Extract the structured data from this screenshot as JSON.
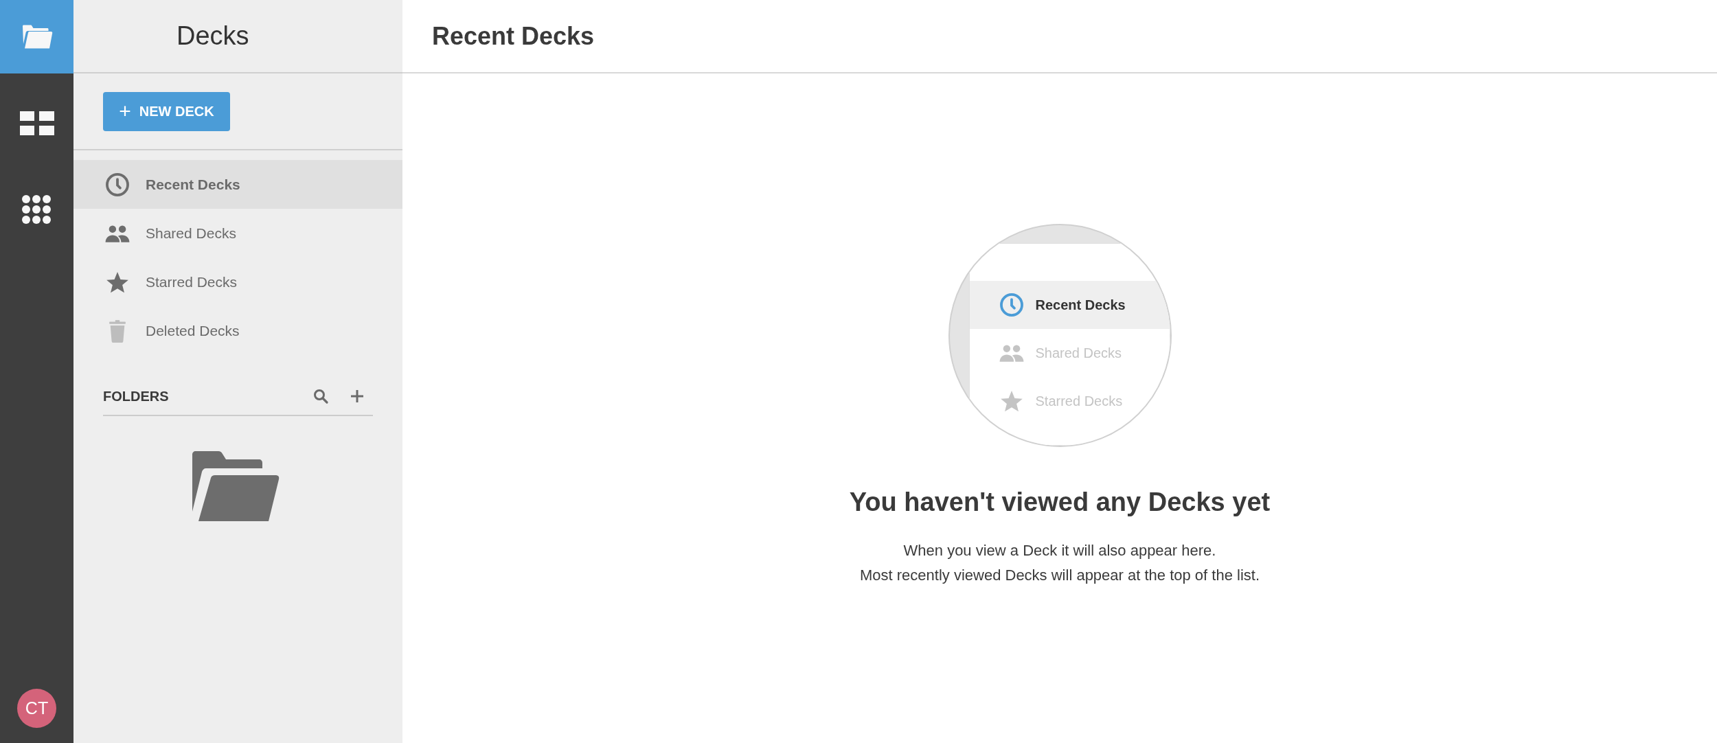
{
  "rail": {
    "items": [
      {
        "kind": "folder",
        "selected": true
      },
      {
        "kind": "grid",
        "selected": false
      },
      {
        "kind": "apps",
        "selected": false
      }
    ],
    "avatar": {
      "initials": "CT",
      "color": "#d4637a"
    }
  },
  "sidebar": {
    "title": "Decks",
    "new_button": {
      "icon": "+",
      "label": "NEW DECK"
    },
    "items": [
      {
        "kind": "clock",
        "label": "Recent Decks",
        "selected": true
      },
      {
        "kind": "people",
        "label": "Shared Decks",
        "selected": false
      },
      {
        "kind": "star",
        "label": "Starred Decks",
        "selected": false
      },
      {
        "kind": "trash",
        "label": "Deleted Decks",
        "selected": false
      }
    ],
    "folders": {
      "title": "FOLDERS"
    }
  },
  "main": {
    "title": "Recent Decks",
    "illustration": {
      "items": [
        {
          "kind": "clock",
          "label": "Recent Decks",
          "selected": true
        },
        {
          "kind": "people",
          "label": "Shared Decks",
          "selected": false
        },
        {
          "kind": "star",
          "label": "Starred Decks",
          "selected": false
        }
      ]
    },
    "empty_title": "You haven't viewed any Decks yet",
    "empty_lines": [
      "When you view a Deck it will also appear here.",
      "Most recently viewed Decks will appear at the top of the list."
    ]
  }
}
